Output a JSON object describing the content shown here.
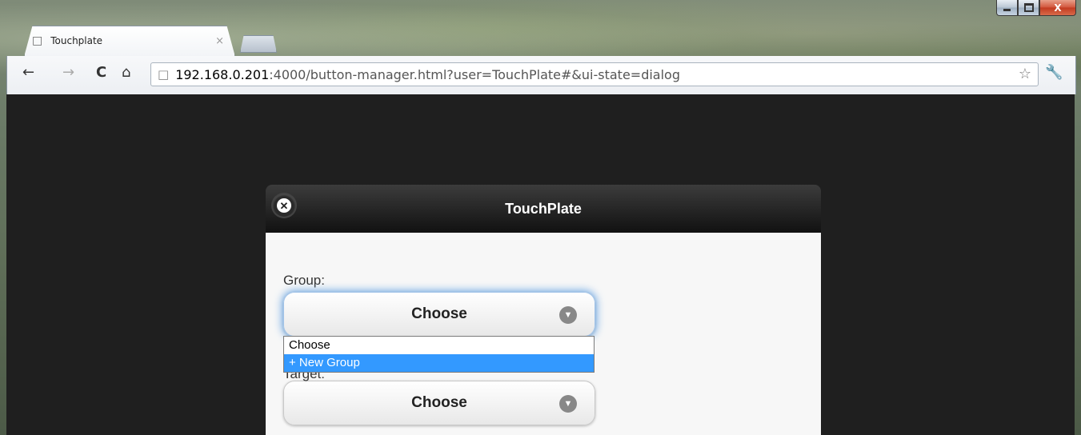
{
  "browser": {
    "tab_title": "Touchplate",
    "tab_close": "×",
    "url_host": "192.168.0.201",
    "url_rest": ":4000/button-manager.html?user=TouchPlate#&ui-state=dialog",
    "back_icon": "←",
    "forward_icon": "→",
    "reload_icon": "C",
    "home_icon": "⌂",
    "star_icon": "☆",
    "wrench_icon": "🔧",
    "window_close": "X"
  },
  "dialog": {
    "title": "TouchPlate",
    "close_icon": "✕",
    "group": {
      "label": "Group:",
      "value": "Choose"
    },
    "target": {
      "label": "Target:",
      "value": "Choose"
    },
    "dropdown": {
      "options": [
        "Choose",
        "+ New Group"
      ],
      "highlighted": "+ New Group"
    }
  }
}
